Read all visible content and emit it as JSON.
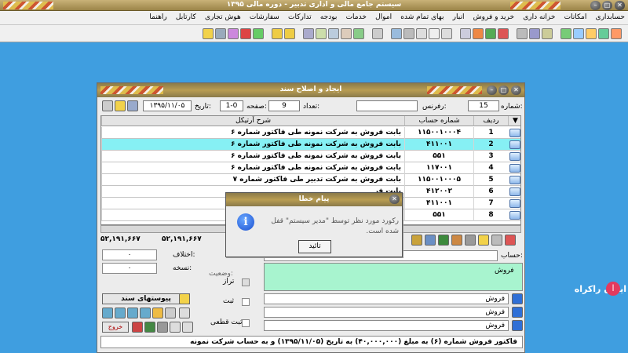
{
  "app": {
    "title": "سیستم جامع مالی و اداری تدبیر - دوره مالی ۱۳۹۵"
  },
  "menu": {
    "items": [
      "حسابداری",
      "امکانات",
      "خزانه داری",
      "خرید و فروش",
      "انبار",
      "بهای تمام شده",
      "اموال",
      "خدمات",
      "بودجه",
      "تدارکات",
      "سفارشات",
      "هوش تجاری",
      "کارتابل",
      "راهنما"
    ]
  },
  "doc_window": {
    "title": "ایجاد و اصلاح سند",
    "number_label": "شماره:",
    "number_value": "15",
    "reference_label": "رفرنس:",
    "reference_value": "",
    "count_label": "تعداد:",
    "count_value": "9",
    "page_label": "صفحه:",
    "page_value": "1-0",
    "date_label": "تاریخ:",
    "date_value": "۱۳۹۵/۱۱/۰۵",
    "grid": {
      "columns": [
        "ردیف",
        "شماره حساب",
        "شرح آرتیکل"
      ],
      "rows": [
        {
          "row": "1",
          "account": "۱۱۵۰۰۱۰۰۰۴",
          "desc": "بابت فروش به شرکت نمونه طی فاکتور شماره ۶"
        },
        {
          "row": "2",
          "account": "۴۱۱۰۰۱",
          "desc": "بابت فروش به شرکت نمونه طی فاکتور شماره ۶"
        },
        {
          "row": "3",
          "account": "۵۵۱",
          "desc": "بابت فروش به شرکت نمونه طی فاکتور شماره ۶"
        },
        {
          "row": "4",
          "account": "۱۱۷۰۰۱",
          "desc": "بابت فروش به شرکت نمونه طی فاکتور شماره ۶"
        },
        {
          "row": "5",
          "account": "۱۱۵۰۰۱۰۰۰۵",
          "desc": "بابت فروش به شرکت تدبیر طی فاکتور شماره ۷"
        },
        {
          "row": "6",
          "account": "۴۱۲۰۰۲",
          "desc": "بابت فر"
        },
        {
          "row": "7",
          "account": "۴۱۱۰۰۱",
          "desc": "بابت فر"
        },
        {
          "row": "8",
          "account": "۵۵۱",
          "desc": "بابت فر"
        }
      ]
    },
    "totals": {
      "debit": "۵۲,۱۹۱,۶۶۷",
      "credit": "۵۲,۱۹۱,۶۶۷"
    },
    "diff_label": "اختلاف:",
    "diff_value": "۰",
    "copy_label": "نسخه:",
    "copy_value": "۰",
    "account_label": "حساب:",
    "status_label": "وضعیت:",
    "status_options": [
      {
        "label": "تراز",
        "checked": true
      },
      {
        "label": "ثبت",
        "checked": false
      },
      {
        "label": "ثبت قطعی",
        "checked": false
      }
    ],
    "attachments_button": "پیوستهای سند",
    "delete_button": "خروج",
    "green_field_text": "فروش",
    "sub_fields": [
      "فروش",
      "فروش",
      "فروش"
    ],
    "footer_text": "فاکتور فروش شماره (۶) به مبلغ (۴۰,۰۰۰,۰۰۰) به تاریخ (۱۳۹۵/۱۱/۰۵) و به حساب شرکت نمونه"
  },
  "dialog": {
    "title": "پیام خطا",
    "message": "رکورد مورد نظر توسط \"مدیر سیستم\" قفل شده است.",
    "ok_button": "تائید"
  },
  "watermark": {
    "text": "ایمان راکراه"
  },
  "colors": {
    "desktop": "#3f9ee0",
    "selected_row": "#86f0f4",
    "green_field": "#a8f4cf",
    "title_gold": "#b99d52"
  }
}
